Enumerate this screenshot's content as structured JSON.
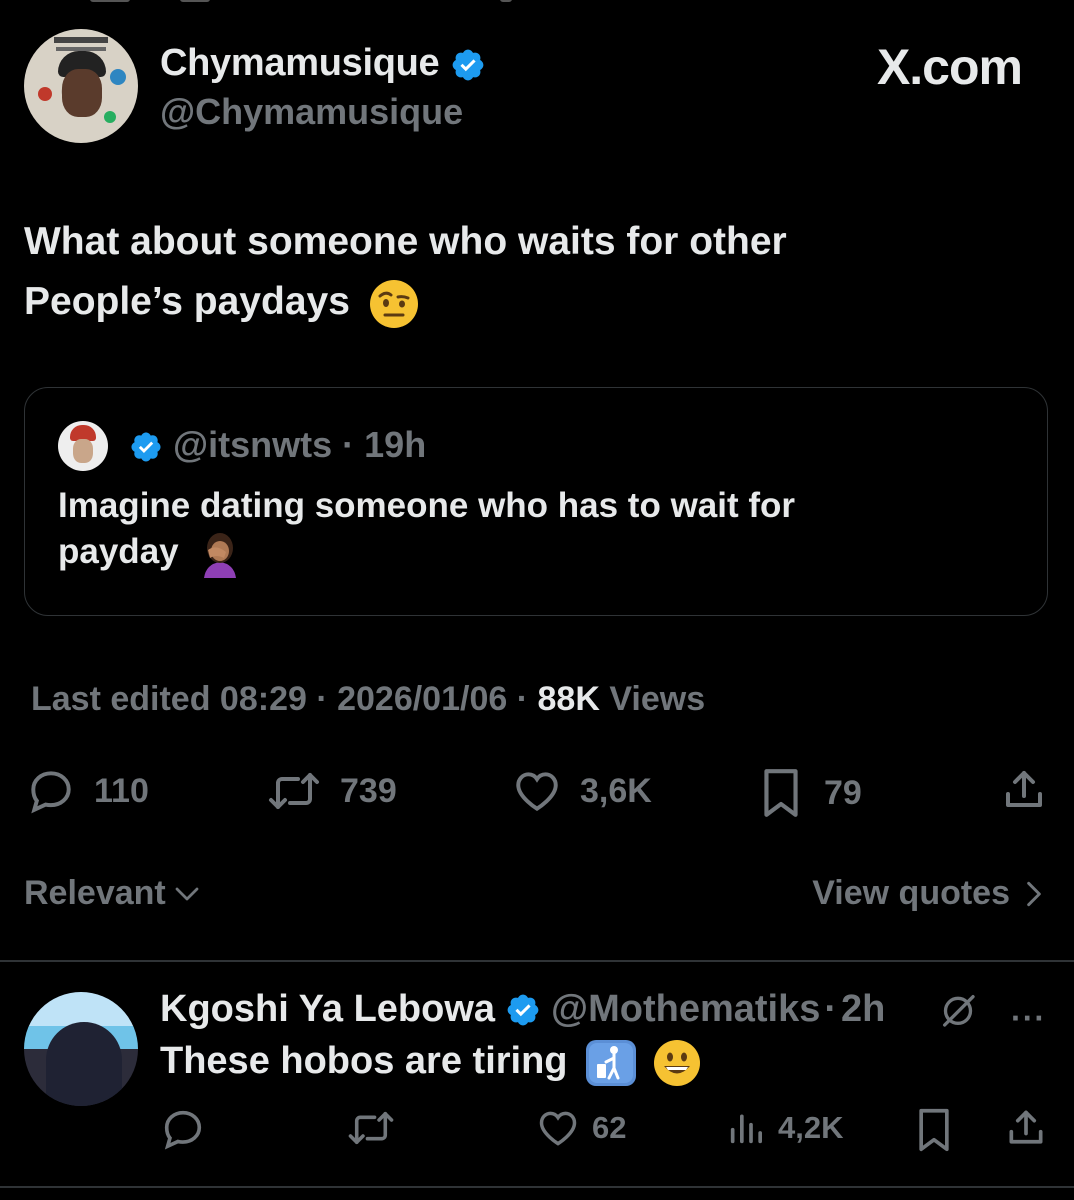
{
  "header": {
    "display_name": "Chymamusique",
    "handle": "@Chymamusique",
    "site_label": "X.com"
  },
  "tweet": {
    "text_line1": "What about someone who waits for other",
    "text_line2": "People’s paydays",
    "emoji": "face-with-raised-eyebrow"
  },
  "quoted": {
    "handle": "@itsnwts",
    "separator": "·",
    "time": "19h",
    "text_line1": "Imagine dating someone who has to wait for",
    "text_line2": "payday",
    "emoji": "woman-facepalming"
  },
  "meta": {
    "edited": "Last edited 08:29 · 2026/01/06 ·",
    "views_count": "88K",
    "views_label": "Views"
  },
  "actions": {
    "replies": "110",
    "reposts": "739",
    "likes": "3,6K",
    "bookmarks": "79"
  },
  "sort": {
    "label": "Relevant",
    "view_quotes": "View quotes"
  },
  "reply": {
    "name": "Kgoshi Ya Lebowa",
    "handle": "@Mothematiks",
    "separator": "·",
    "time": "2h",
    "text": "These hobos are tiring",
    "emojis": [
      "put-litter-in-its-place",
      "grinning-face"
    ],
    "likes": "62",
    "views": "4,2K",
    "more": "···"
  },
  "colors": {
    "background": "#000000",
    "text": "#e7e9ea",
    "muted": "#71767b",
    "verified": "#1d9bf0",
    "border": "#2f3336"
  }
}
